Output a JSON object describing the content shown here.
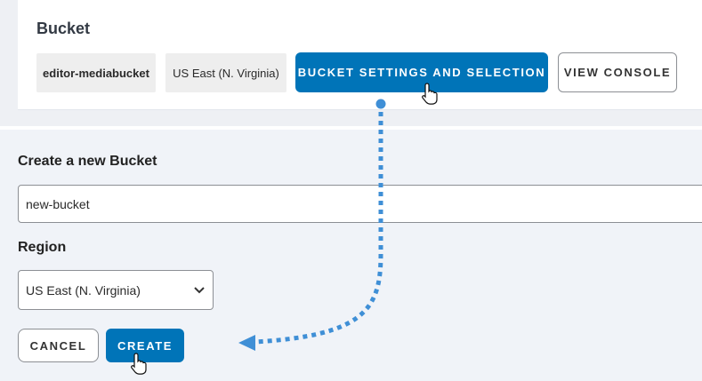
{
  "bucket": {
    "title": "Bucket",
    "name": "editor-mediabucket",
    "region": "US East (N. Virginia)",
    "settings_label": "BUCKET SETTINGS AND SELECTION",
    "console_label": "VIEW CONSOLE"
  },
  "new_bucket": {
    "title": "Create a new Bucket",
    "name_value": "new-bucket",
    "region_label": "Region",
    "region_selected": "US East (N. Virginia)",
    "cancel_label": "CANCEL",
    "create_label": "CREATE"
  },
  "colors": {
    "primary": "#0074b8",
    "annotation_arrow": "#3f8fd6"
  },
  "icons": {
    "cursor": "hand-pointer-icon",
    "select_caret": "chevron-down-icon"
  }
}
